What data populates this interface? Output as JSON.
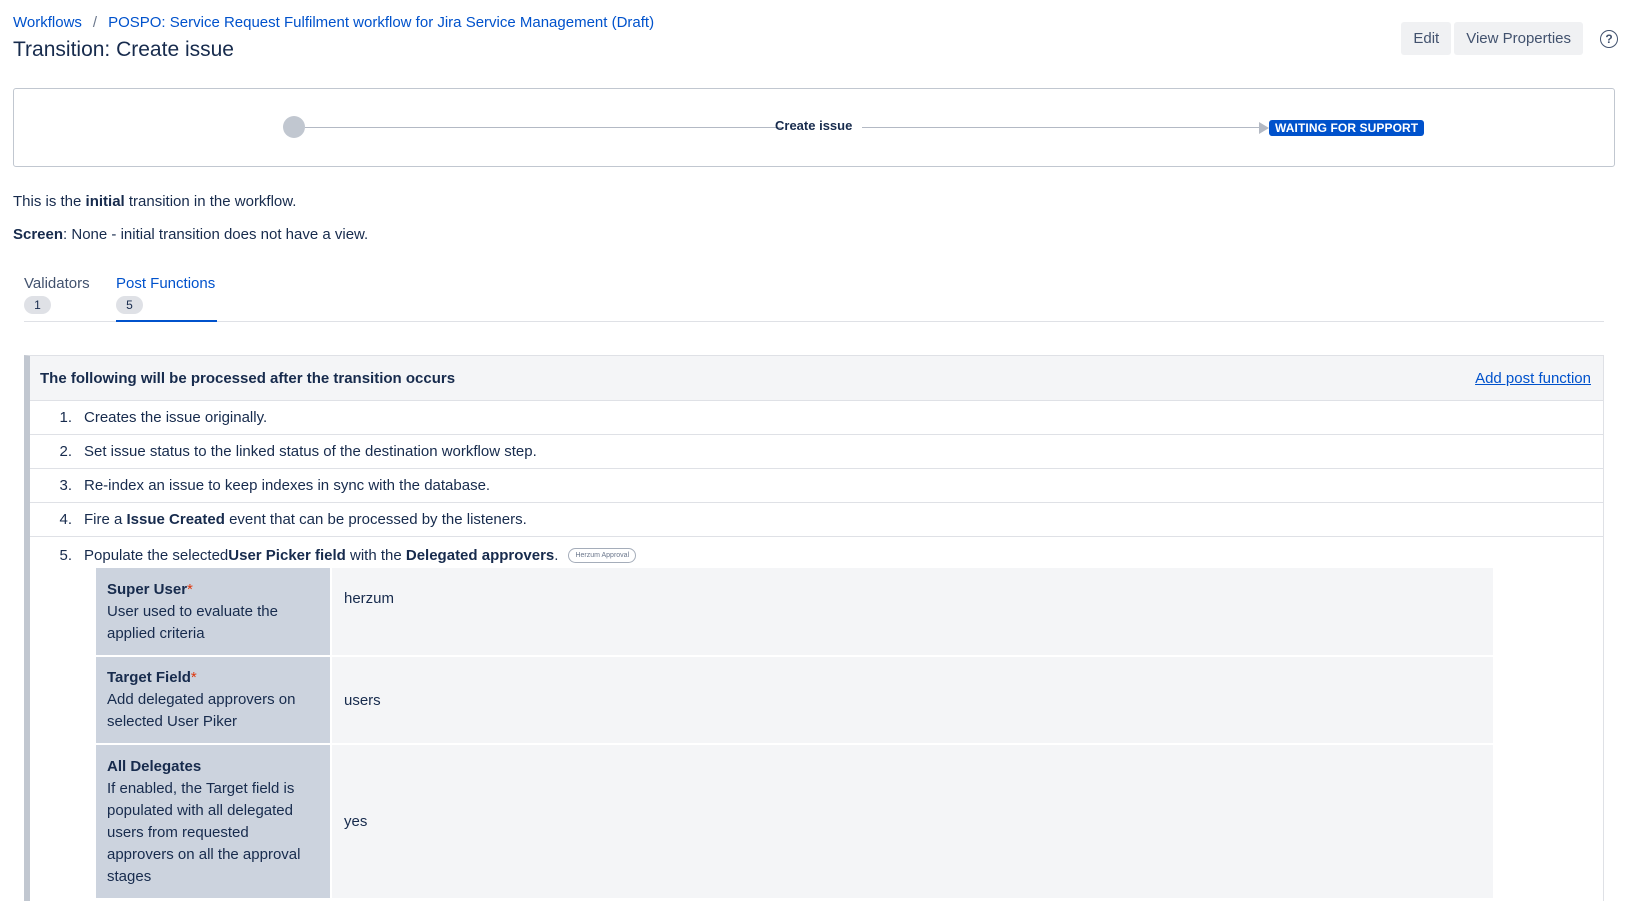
{
  "breadcrumb": {
    "root": "Workflows",
    "separator": "/",
    "workflow": "POSPO: Service Request Fulfilment workflow for Jira Service Management (Draft)"
  },
  "title": "Transition: Create issue",
  "actions": {
    "edit": "Edit",
    "view_properties": "View Properties",
    "help_glyph": "?"
  },
  "diagram": {
    "transition_label": "Create issue",
    "target_status": "WAITING FOR SUPPORT"
  },
  "info": {
    "line1_prefix": "This is the ",
    "line1_bold": "initial",
    "line1_suffix": " transition in the workflow.",
    "screen_label": "Screen",
    "screen_text": ": None - initial transition does not have a view."
  },
  "tabs": [
    {
      "label": "Validators",
      "count": "1"
    },
    {
      "label": "Post Functions",
      "count": "5"
    }
  ],
  "panel": {
    "title": "The following will be processed after the transition occurs",
    "add_link": "Add post function",
    "functions": [
      {
        "num": "1.",
        "text": "Creates the issue originally."
      },
      {
        "num": "2.",
        "text": "Set issue status to the linked status of the destination workflow step."
      },
      {
        "num": "3.",
        "text": "Re-index an issue to keep indexes in sync with the database."
      },
      {
        "num": "4.",
        "pre": "Fire a ",
        "bold": "Issue Created",
        "post": " event that can be processed by the listeners."
      }
    ],
    "fifth": {
      "num": "5.",
      "pre": "Populate the selected ",
      "bold1": "User Picker field",
      "mid": " with the ",
      "bold2": "Delegated approvers",
      "post": ".",
      "badge": "Herzum Approval",
      "config": [
        {
          "name": "Super User",
          "required": "*",
          "desc": "User used to evaluate the applied criteria",
          "value": "herzum"
        },
        {
          "name": "Target Field",
          "required": "*",
          "desc": "Add delegated approvers on selected User Piker",
          "value": "users"
        },
        {
          "name": "All Delegates",
          "required": "",
          "desc": "If enabled, the Target field is populated with all delegated users from requested approvers on all the approval stages",
          "value": "yes"
        }
      ]
    }
  },
  "colors": {
    "link": "#0052cc",
    "lozenge": "#0052cc",
    "required": "#de350b"
  }
}
